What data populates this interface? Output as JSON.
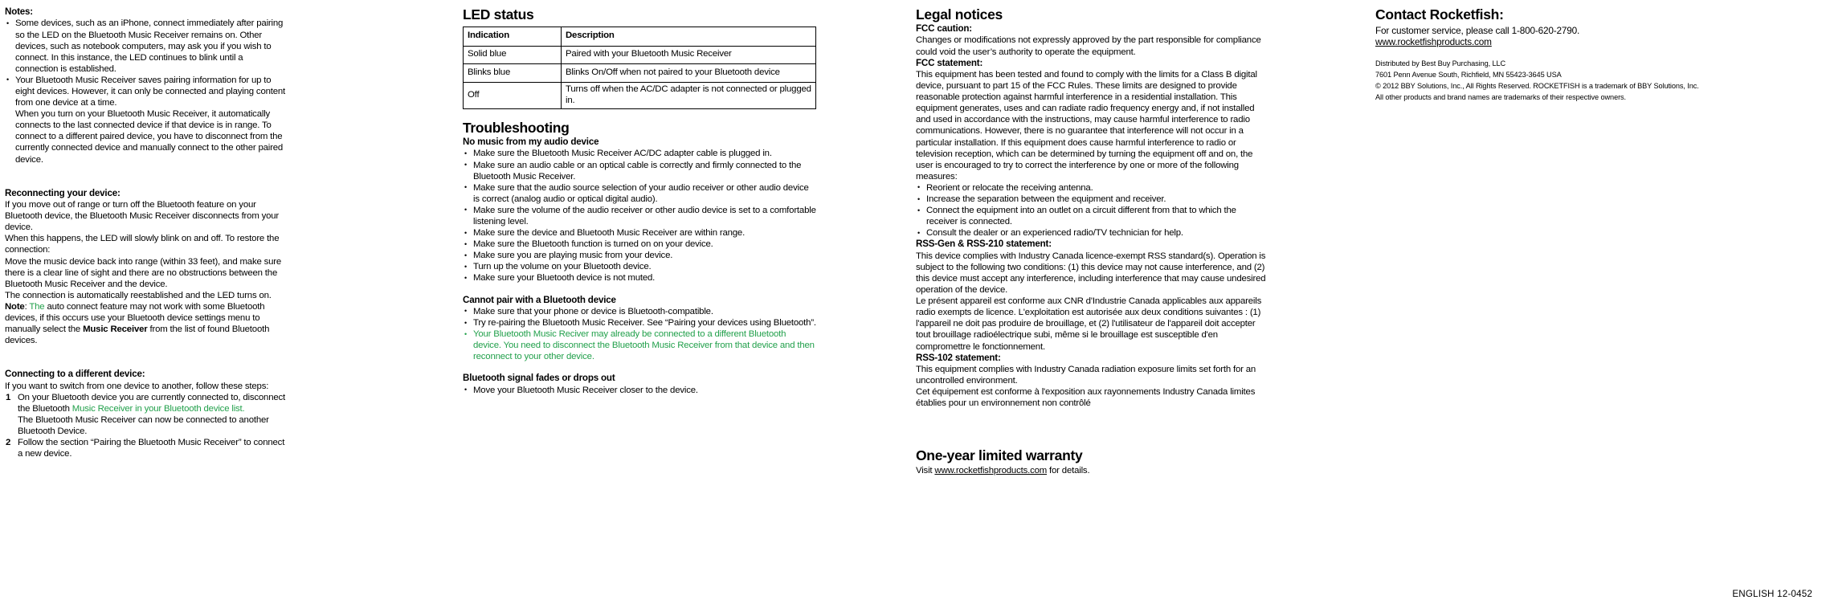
{
  "document": {
    "footer_code": "ENGLISH 12-0452"
  },
  "column1": {
    "notes_heading": "Notes:",
    "notes": [
      "Some devices, such as an iPhone, connect immediately after pairing so the LED on the Bluetooth Music Receiver remains on. Other devices, such as notebook computers, may ask you if you wish to connect. In this instance, the LED continues to blink until a connection is established.",
      "Your Bluetooth Music Receiver saves pairing information for up to eight devices. However, it can only be connected and playing content from one device at a time."
    ],
    "note2_continuation": "When you turn on your Bluetooth Music Receiver, it automatically connects to the last connected device if that device is in range. To connect to a different paired device, you have to disconnect from the currently connected device and manually connect to the other paired device.",
    "reconnect_heading": "Reconnecting your device:",
    "reconnect_p1": "If you move out of range or turn off the Bluetooth feature on your Bluetooth device, the Bluetooth Music Receiver disconnects from your device.",
    "reconnect_p2": "When this happens, the LED will slowly blink on and off. To restore the connection:",
    "reconnect_p3": "Move the music device back into range (within 33 feet), and make sure there is a clear line of sight and there are no obstructions between the Bluetooth Music Receiver and the device.",
    "reconnect_p4": "The connection is automatically reestablished and the LED turns on.",
    "note_label": "Note",
    "note_colon": ": ",
    "note_green": "The",
    "note_rest_a": " auto connect feature may not work with some Bluetooth devices, if this occurs use your Bluetooth device settings menu to manually select the ",
    "note_bold": "Music Receiver",
    "note_rest_b": " from the list of found Bluetooth devices.",
    "connect_heading": "Connecting to a different device:",
    "connect_intro": "If you want to switch from one device to another, follow these steps:",
    "step1_black": "On your Bluetooth device you are currently connected to, disconnect the Bluetooth ",
    "step1_green": "Music Receiver in your Bluetooth device list.",
    "step1_sub": "The  Bluetooth Music Receiver can now be connected to another Bluetooth Device.",
    "step2": "Follow the section “Pairing the Bluetooth Music Receiver” to connect a new device."
  },
  "column2": {
    "led_heading": "LED status",
    "led_table": {
      "columns": [
        "Indication",
        "Description"
      ],
      "rows": [
        [
          "Solid blue",
          "Paired with your Bluetooth Music Receiver"
        ],
        [
          "Blinks blue",
          "Blinks On/Off when not paired to your Bluetooth device"
        ],
        [
          "Off",
          "Turns off when the AC/DC adapter is not connected or plugged in."
        ]
      ]
    },
    "troubleshooting_heading": "Troubleshooting",
    "no_music_heading": "No music from my audio device",
    "no_music_items": [
      "Make sure the Bluetooth Music Receiver AC/DC adapter cable is plugged in.",
      "Make sure an audio cable or an optical cable is correctly and firmly connected to the Bluetooth Music Receiver.",
      "Make sure that the audio source selection of your audio receiver or other audio device is correct (analog audio or optical digital audio).",
      "Make sure the volume of the audio receiver or other audio device is set to a comfortable listening level.",
      "Make sure the device and Bluetooth Music Receiver are within range.",
      "Make sure the Bluetooth function is turned on on your device.",
      "Make sure you are playing music from your device.",
      "Turn up the volume on your Bluetooth device.",
      "Make sure your Bluetooth device is not muted."
    ],
    "cannot_pair_heading": "Cannot pair with a Bluetooth device",
    "cannot_pair_items": [
      "Make sure that your phone or device is Bluetooth-compatible.",
      "Try re-pairing the Bluetooth Music Receiver. See “Pairing your devices using Bluetooth”."
    ],
    "cannot_pair_green_item": "Your Bluetooth Music Reciver may already be connected to a different Bluetooth device. You need to disconnect the Bluetooth Music Receiver from that device and then reconnect to your other device.",
    "signal_heading": "Bluetooth signal fades or drops out",
    "signal_items": [
      "Move your Bluetooth Music Receiver closer to the device."
    ]
  },
  "column3": {
    "legal_heading": "Legal notices",
    "fcc_caution_heading": "FCC caution:",
    "fcc_caution_text": "Changes or modifications not expressly approved by the part responsible for compliance could void the user’s authority to operate the equipment.",
    "fcc_statement_heading": "FCC statement:",
    "fcc_statement_text": "This equipment has been tested and found to comply with the limits for a Class B digital device, pursuant to part 15 of the FCC Rules. These limits are designed to provide reasonable protection against harmful interference in a residential installation. This equipment generates, uses and can radiate radio frequency energy and, if not installed and used in accordance with the instructions, may cause harmful interference to radio communications. However, there is no guarantee that interference will not occur in a particular installation. If this equipment does cause harmful interference to radio or television reception, which can be determined by turning the equipment off and on, the user is encouraged to try to correct the interference by one or more of the following measures:",
    "fcc_measures": [
      "Reorient or relocate the receiving antenna.",
      "Increase the separation between the equipment and receiver.",
      "Connect the equipment into an outlet on a circuit different from that to which the receiver is connected.",
      "Consult the dealer or an experienced radio/TV technician for help."
    ],
    "rss_gen_heading": "RSS-Gen & RSS-210 statement:",
    "rss_gen_en": "This device complies with Industry Canada licence-exempt RSS standard(s). Operation is subject to the following two conditions: (1) this device may not cause interference, and (2) this device must accept any interference, including interference that may cause undesired operation of the device.",
    "rss_gen_fr": "Le présent appareil est conforme aux CNR d'Industrie Canada applicables aux appareils radio exempts de licence. L'exploitation est autorisée aux deux conditions suivantes : (1) l'appareil ne doit pas produire de brouillage, et (2) l'utilisateur de l'appareil doit accepter tout brouillage radioélectrique subi, même si le brouillage est susceptible d'en compromettre le fonctionnement.",
    "rss_102_heading": "RSS-102 statement:",
    "rss_102_en": "This equipment complies with Industry Canada radiation exposure limits set forth for an uncontrolled environment.",
    "rss_102_fr": "Cet équipement est conforme à l'exposition aux rayonnements Industry Canada limites établies pour un environnement non contrôlé",
    "warranty_heading": "One-year limited warranty",
    "warranty_visit": "Visit ",
    "warranty_link": "www.rocketfishproducts.com",
    "warranty_tail": " for details."
  },
  "column4": {
    "contact_heading": "Contact Rocketfish:",
    "contact_phone_line": "For customer service, please call 1-800-620-2790.",
    "contact_url": "www.rocketfishproducts.com",
    "distributed_by": "Distributed by Best Buy Purchasing, LLC",
    "address": "7601 Penn Avenue South, Richfield, MN 55423-3645 USA",
    "copyright": "© 2012 BBY Solutions, Inc., All Rights Reserved. ROCKETFISH is a trademark of BBY Solutions, Inc.",
    "trademarks": "All other products and brand names are trademarks of their respective owners."
  },
  "colors": {
    "green_accent": "#22a04b",
    "text": "#000000",
    "background": "#ffffff"
  }
}
